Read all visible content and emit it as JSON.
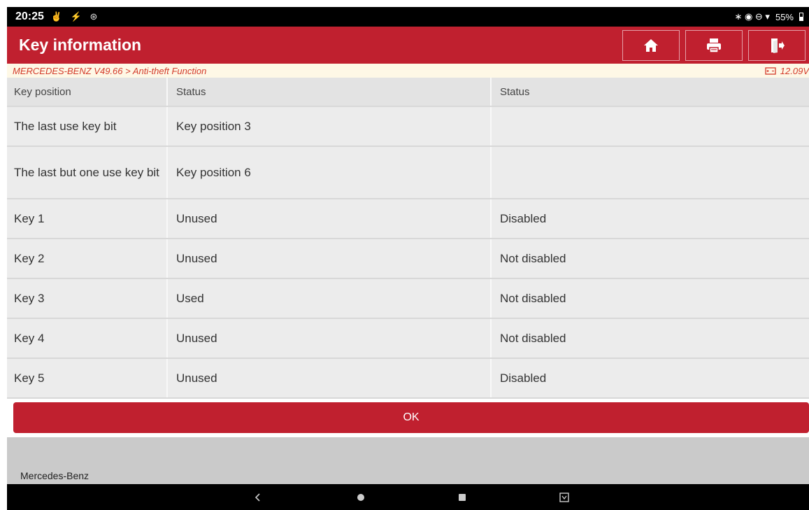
{
  "status_bar": {
    "time": "20:25",
    "left_icons": "✌ ⚡ ⊛",
    "right_icons": "∗ ◉ ⊖ ▾",
    "battery": "55%"
  },
  "header": {
    "title": "Key information",
    "accent_color": "#c0202f"
  },
  "breadcrumb": {
    "path": "MERCEDES-BENZ V49.66 > Anti-theft Function",
    "voltage": "12.09V"
  },
  "table": {
    "columns": [
      "Key position",
      "Status",
      "Status"
    ],
    "rows": [
      [
        "The last use key bit",
        "Key position 3",
        ""
      ],
      [
        "The last but one use key bit",
        "Key position 6",
        ""
      ],
      [
        "Key 1",
        "Unused",
        "Disabled"
      ],
      [
        "Key 2",
        "Unused",
        "Not disabled"
      ],
      [
        "Key 3",
        "Used",
        "Not disabled"
      ],
      [
        "Key 4",
        "Unused",
        "Not disabled"
      ],
      [
        "Key 5",
        "Unused",
        "Disabled"
      ]
    ]
  },
  "ok_button": {
    "label": "OK"
  },
  "footer": {
    "brand": "Mercedes-Benz"
  },
  "nav_bar": {
    "icons": [
      "back-icon",
      "home-circle-icon",
      "recents-icon",
      "screenshot-icon"
    ]
  }
}
